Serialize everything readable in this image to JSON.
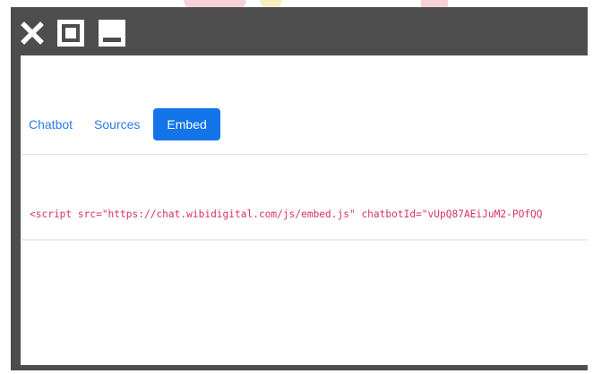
{
  "window": {
    "controls": {
      "close_icon": "close-icon",
      "maximize_icon": "maximize-icon",
      "minimize_icon": "minimize-icon"
    }
  },
  "tabs": [
    {
      "label": "Chatbot",
      "active": false
    },
    {
      "label": "Sources",
      "active": false
    },
    {
      "label": "Embed",
      "active": true
    }
  ],
  "embed": {
    "code": "<script src=\"https://chat.wibidigital.com/js/embed.js\" chatbotId=\"vUpQ87AEiJuM2-POfQQ"
  },
  "colors": {
    "titlebar": "#4d4d4d",
    "tab_link": "#2b7de9",
    "tab_active_bg": "#1274e8",
    "code_text": "#d6336c"
  }
}
